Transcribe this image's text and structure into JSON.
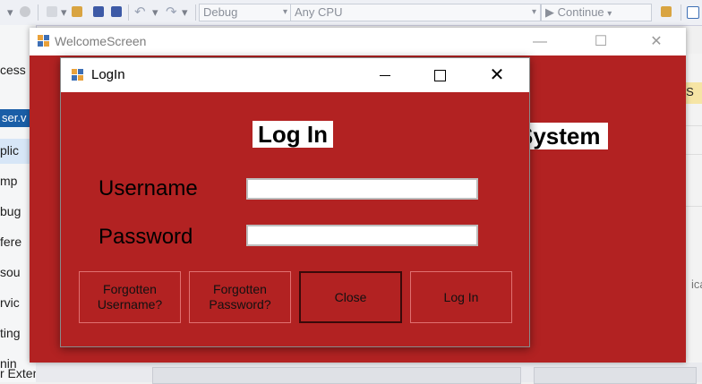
{
  "vs": {
    "config": "Debug",
    "platform": "Any CPU",
    "continue_label": "Continue",
    "left_items": [
      "cess",
      "ser.v",
      "plic",
      "mp",
      "bug",
      "fere",
      "sou",
      "rvic",
      "ting",
      "nin"
    ],
    "left_bottom": "r Extensions",
    "right_tab": "k S",
    "right_text": "ica"
  },
  "welcome": {
    "title": "WelcomeScreen",
    "system_label": "System"
  },
  "login": {
    "title": "LogIn",
    "heading": "Log In",
    "username_label": "Username",
    "password_label": "Password",
    "username_value": "",
    "password_value": "",
    "buttons": {
      "forgot_username": "Forgotten Username?",
      "forgot_password": "Forgotten Password?",
      "close": "Close",
      "login": "Log In"
    }
  },
  "colors": {
    "form_bg": "#b22222",
    "vs_accent": "#1a5ea7"
  }
}
